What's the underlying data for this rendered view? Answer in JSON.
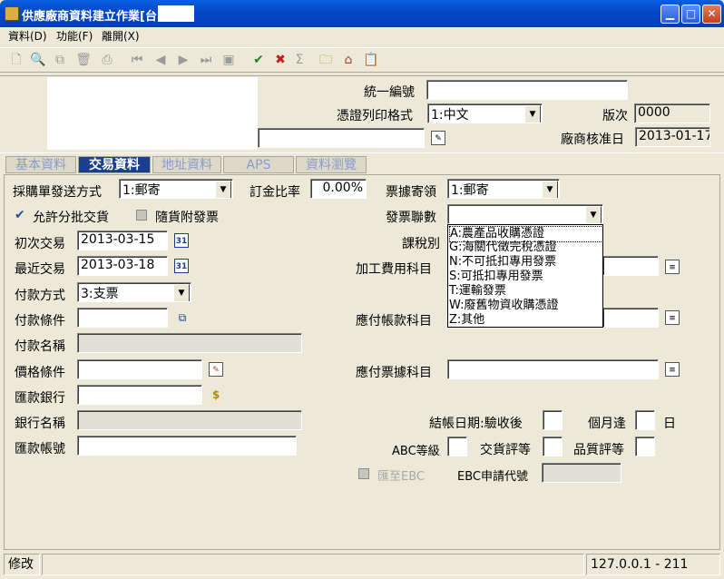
{
  "window": {
    "title": "供應廠商資料建立作業[台      亮]"
  },
  "menu": [
    "資料(D)",
    "功能(F)",
    "離開(X)"
  ],
  "header": {
    "tax_id_label": "統一編號",
    "tax_id_value": "",
    "voucher_print_label": "憑證列印格式",
    "voucher_print_value": "1:中文",
    "version_label": "版次",
    "version_value": "0000",
    "approval_date_label": "廠商核准日",
    "approval_date_value": "2013-01-17"
  },
  "tabs": [
    "基本資料",
    "交易資料",
    "地址資料",
    "APS",
    "資料瀏覽"
  ],
  "form": {
    "po_send_label": "採購單發送方式",
    "po_send_value": "1:郵寄",
    "deposit_label": "訂金比率",
    "deposit_value": "0.00%",
    "receipt_mail_label": "票據寄領",
    "receipt_mail_value": "1:郵寄",
    "partial_delivery_label": "允許分批交貨",
    "invoice_with_goods_label": "隨貨附發票",
    "invoice_copies_label": "發票聯數",
    "invoice_copies_value": "",
    "first_trade_label": "初次交易",
    "first_trade_value": "2013-03-15",
    "tax_type_label": "課稅別",
    "last_trade_label": "最近交易",
    "last_trade_value": "2013-03-18",
    "processing_fee_label": "加工費用科目",
    "payment_method_label": "付款方式",
    "payment_method_value": "3:支票",
    "payment_terms_label": "付款條件",
    "payment_terms_value": "",
    "payable_account_label": "應付帳款科目",
    "payment_name_label": "付款名稱",
    "price_terms_label": "價格條件",
    "notes_payable_label": "應付票據科目",
    "remit_bank_label": "匯款銀行",
    "bank_name_label": "銀行名稱",
    "closing_label": "結帳日期:驗收後",
    "months_label": "個月逢",
    "day_label": "日",
    "remit_account_label": "匯款帳號",
    "abc_label": "ABC等級",
    "delivery_rating_label": "交貨評等",
    "quality_rating_label": "品質評等",
    "ebc_label": "匯至EBC",
    "ebc_code_label": "EBC申請代號"
  },
  "invoice_options": [
    "A:農產品收購憑證",
    "G:海關代徵完稅憑證",
    "N:不可抵扣專用發票",
    "S:可抵扣專用發票",
    "T:運輸發票",
    "W:廢舊物資收購憑證",
    "Z:其他"
  ],
  "status": {
    "mode": "修改",
    "server": "127.0.0.1 - 211"
  }
}
